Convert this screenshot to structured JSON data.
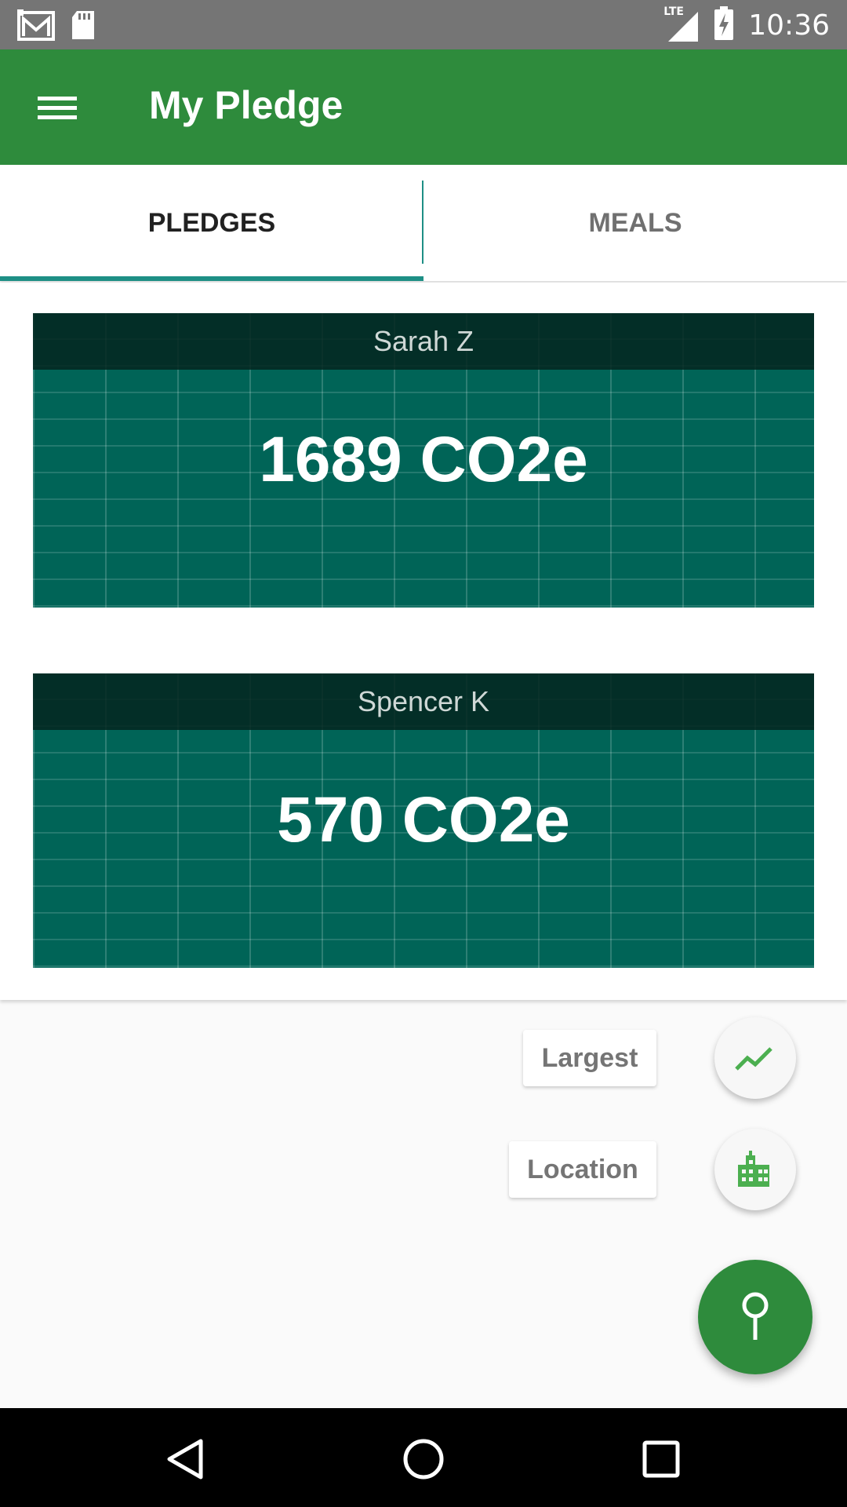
{
  "status_bar": {
    "time": "10:36",
    "network": "LTE",
    "left_icons": [
      "gmail-icon",
      "sd-card-icon"
    ],
    "right_icons": [
      "signal-icon",
      "battery-charging-icon"
    ]
  },
  "app_bar": {
    "title": "My Pledge",
    "menu_icon": "hamburger-menu-icon",
    "color": "#2e8b3c"
  },
  "tabs": [
    {
      "label": "PLEDGES",
      "active": true
    },
    {
      "label": "MEALS",
      "active": false
    }
  ],
  "pledges": [
    {
      "name": "Sarah Z",
      "value": "1689 CO2e"
    },
    {
      "name": "Spencer K",
      "value": "570 CO2e"
    }
  ],
  "fab_menu": {
    "items": [
      {
        "label": "Largest",
        "icon": "trending-up-icon"
      },
      {
        "label": "Location",
        "icon": "city-icon"
      }
    ],
    "main_icon": "pin-icon"
  },
  "nav_bar": {
    "buttons": [
      "back-icon",
      "home-icon",
      "recents-icon"
    ]
  }
}
